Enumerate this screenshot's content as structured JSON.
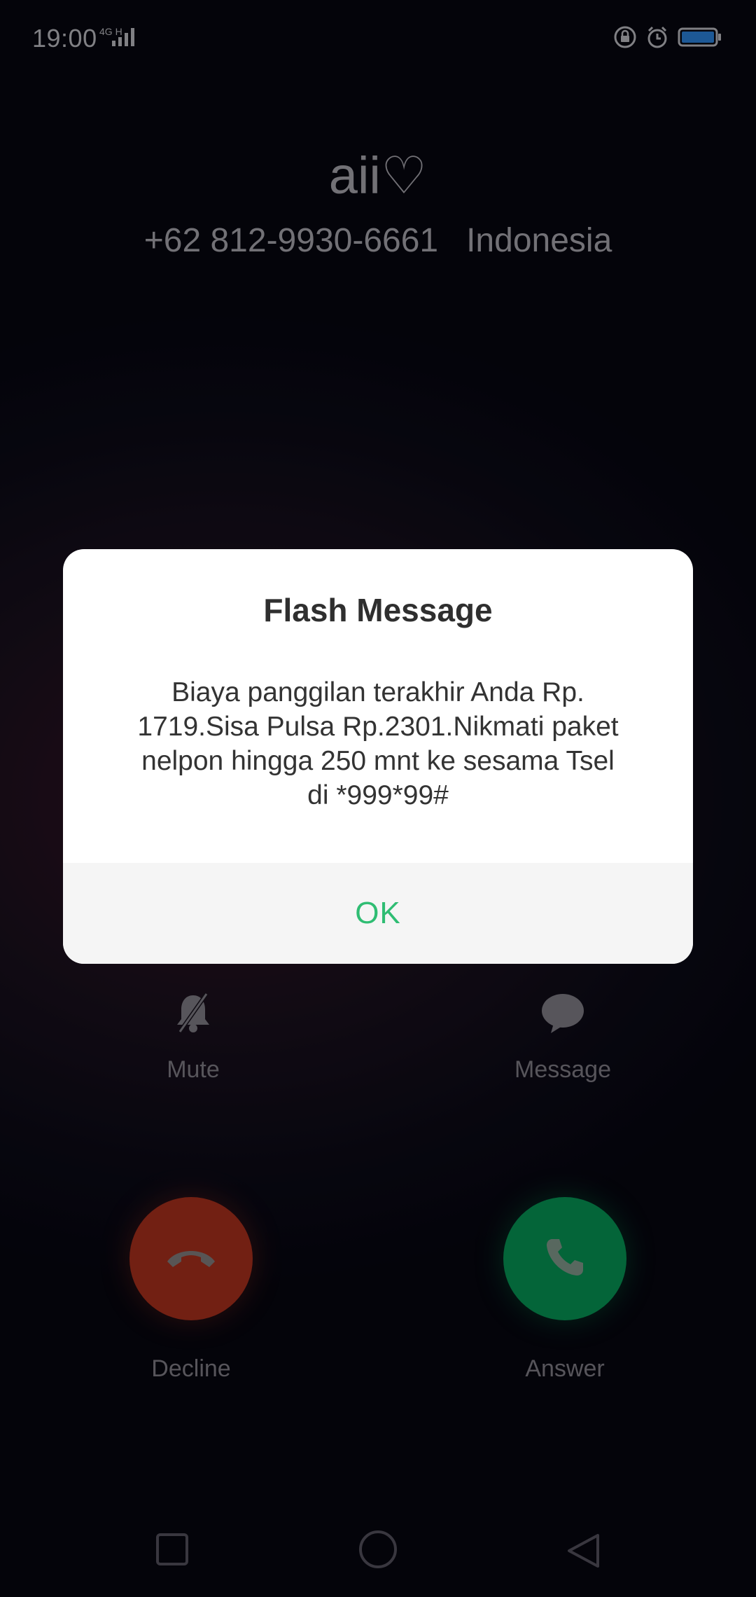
{
  "status_bar": {
    "time": "19:00",
    "network": "4G H",
    "icons": [
      "signal-icon",
      "lock-rotation-icon",
      "alarm-icon",
      "battery-icon"
    ]
  },
  "caller": {
    "name": "aii♡",
    "number": "+62 812-9930-6661",
    "location": "Indonesia"
  },
  "actions": {
    "mute_label": "Mute",
    "message_label": "Message"
  },
  "call_buttons": {
    "decline_label": "Decline",
    "answer_label": "Answer"
  },
  "dialog": {
    "title": "Flash Message",
    "body_lines": [
      "Biaya panggilan terakhir Anda Rp.",
      "1719.Sisa Pulsa Rp.2301.Nikmati paket",
      "nelpon hingga 250 mnt ke sesama Tsel",
      "di *999*99#"
    ],
    "ok_label": "OK"
  },
  "colors": {
    "accent_ok": "#2fbd73",
    "decline": "#b8351f",
    "answer": "#07a45c"
  },
  "nav_bar": {
    "icons": [
      "recent-apps-icon",
      "home-icon",
      "back-icon"
    ]
  }
}
